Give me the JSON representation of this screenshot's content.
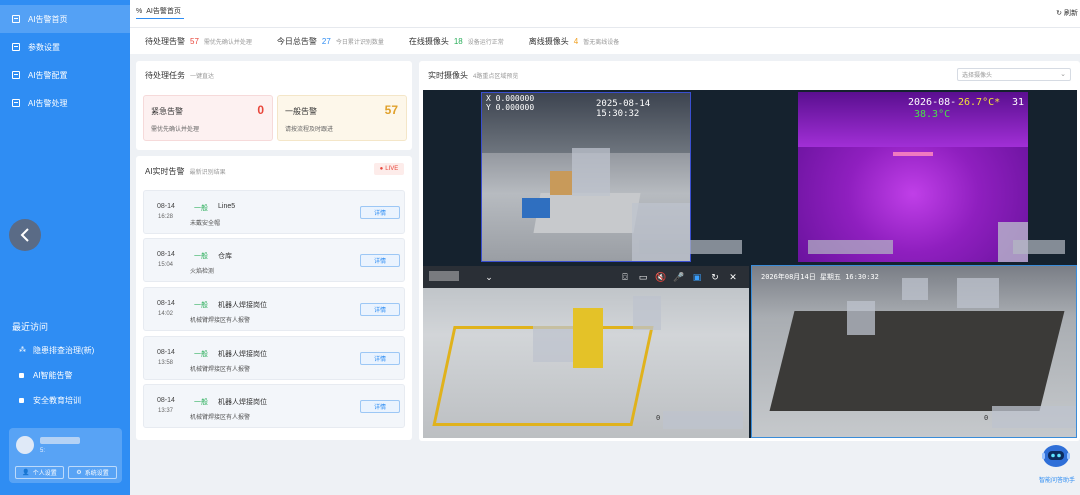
{
  "sidebar": {
    "nav": [
      {
        "label": "AI告警首页"
      },
      {
        "label": "参数设置"
      },
      {
        "label": "AI告警配置"
      },
      {
        "label": "AI告警处理"
      }
    ],
    "recent_title": "最近访问",
    "recent": [
      {
        "label": "隐患排查治理(新)"
      },
      {
        "label": "AI智能告警"
      },
      {
        "label": "安全教育培训"
      }
    ],
    "user": {
      "sub": "5:",
      "personal_settings": "个人设置",
      "system_settings": "系统设置"
    }
  },
  "header": {
    "breadcrumb": "AI告警首页",
    "refresh": "刷新"
  },
  "stats": [
    {
      "label": "待处理告警",
      "value": "57",
      "desc": "需优先确认并处理",
      "color": "#e8463b"
    },
    {
      "label": "今日总告警",
      "value": "27",
      "desc": "今日累计识别数量",
      "color": "#2f8df3"
    },
    {
      "label": "在线摄像头",
      "value": "18",
      "desc": "设备运行正常",
      "color": "#2aae5a"
    },
    {
      "label": "离线摄像头",
      "value": "4",
      "desc": "暂无离线设备",
      "color": "#f0a020"
    }
  ],
  "pending": {
    "title": "待处理任务",
    "subtitle": "一键直达",
    "urgent": {
      "label": "紧急告警",
      "value": "0",
      "desc": "需优先确认并处理"
    },
    "general": {
      "label": "一般告警",
      "value": "57",
      "desc": "请按流程及时跟进"
    }
  },
  "realtime": {
    "title": "AI实时告警",
    "subtitle": "最新识别结果",
    "live": "LIVE",
    "items": [
      {
        "date": "08-14",
        "time": "16:28",
        "level": "一般",
        "location": "Line5",
        "desc": "未戴安全帽",
        "action": "详情"
      },
      {
        "date": "08-14",
        "time": "15:04",
        "level": "一般",
        "location": "仓库",
        "desc": "火焰检测",
        "action": "详情"
      },
      {
        "date": "08-14",
        "time": "14:02",
        "level": "一般",
        "location": "机器人焊接岗位",
        "desc": "机械臂焊接区有人报警",
        "action": "详情"
      },
      {
        "date": "08-14",
        "time": "13:58",
        "level": "一般",
        "location": "机器人焊接岗位",
        "desc": "机械臂焊接区有人报警",
        "action": "详情"
      },
      {
        "date": "08-14",
        "time": "13:37",
        "level": "一般",
        "location": "机器人焊接岗位",
        "desc": "机械臂焊接区有人报警",
        "action": "详情"
      }
    ]
  },
  "cameras": {
    "title": "实时摄像头",
    "subtitle": "4路重点区域预览",
    "select_placeholder": "选择摄像头",
    "feed1": {
      "coords_x": "X 0.000000",
      "coords_y": "Y 0.000000",
      "timestamp": "2025-08-14 15:30:32"
    },
    "feed2": {
      "timestamp": "2026-08-",
      "temp1": "26.7°C*",
      "suffix": "31",
      "temp2": "38.3°C"
    },
    "feed4": {
      "timestamp": "2026年08月14日 星期五 16:30:32"
    },
    "channel_label": "0"
  },
  "assistant": {
    "label": "智能问答助手"
  }
}
